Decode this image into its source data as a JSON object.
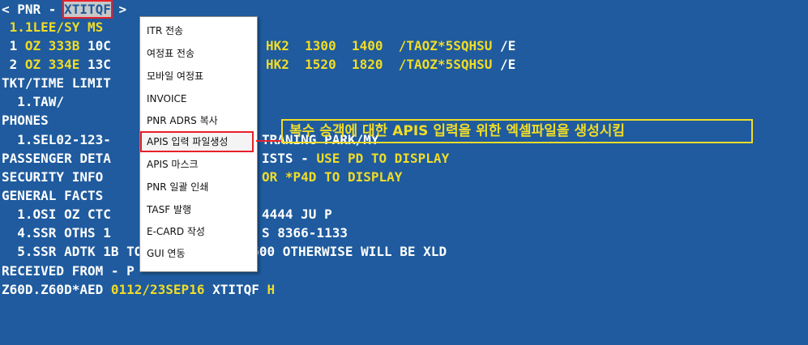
{
  "terminal": {
    "line1": {
      "prefix": "< PNR - ",
      "record_locator": "XTITQF",
      "suffix": " >"
    },
    "line2": {
      "text": " 1.1LEE/SY MS"
    },
    "line3": {
      "a": " 1 ",
      "b": "OZ 333B",
      "c": " 10C",
      "d": "HK2  1300  1400  /TAOZ*",
      "e": "5SQHSU",
      "f": " /E"
    },
    "line4": {
      "a": " 2 ",
      "b": "OZ 334E",
      "c": " 13C",
      "d": "HK2  1520  1820  /TAOZ*",
      "e": "5SQHSU",
      "f": " /E"
    },
    "line5": {
      "text": "TKT/TIME LIMIT"
    },
    "line6": {
      "text": "  1.TAW/"
    },
    "line7": {
      "text": "PHONES"
    },
    "line8": {
      "a": "  1.SEL02-123-",
      "b": "TRANING PARK/MY"
    },
    "line9": {
      "a": "PASSENGER DETA",
      "b": "ISTS - ",
      "c": "USE PD TO DISPLAY"
    },
    "line10": {
      "a": "SECURITY INFO",
      "b": "OR *P4D TO DISPLAY"
    },
    "line11": {
      "text": "GENERAL FACTS"
    },
    "line12": {
      "a": "  1.OSI OZ CTC",
      "b": "4444 JU P"
    },
    "line13": {
      "a": "  4.SSR OTHS 1",
      "b": "S 8366-1133"
    },
    "line14": {
      "text": "  5.SSR ADTK 1B TO OZ BY 28SEP 1600 OTHERWISE WILL BE XLD"
    },
    "line15": {
      "text": "RECEIVED FROM - P"
    },
    "line16": {
      "a": "Z60D.Z60D*AED ",
      "b": "0112/23SEP16",
      "c": " XTITQF ",
      "d": "H"
    }
  },
  "context_menu": {
    "items": [
      "ITR 전송",
      "여정표 전송",
      "모바일 여정표",
      "INVOICE",
      "PNR ADRS 복사",
      "APIS 입력 파일생성",
      "APIS 마스크",
      "PNR 일괄 인쇄",
      "TASF 발행",
      "E-CARD 작성",
      "GUI 연동"
    ],
    "selected_index": 5
  },
  "callout": {
    "text": "복수 승객에 대한 APIS 입력을 위한 엑셀파일을 생성시킴"
  },
  "colors": {
    "terminal_bg": "#1f5b9e",
    "terminal_text": "#ffffff",
    "terminal_yellow": "#f0dc28",
    "highlight_red": "#e8202a"
  }
}
